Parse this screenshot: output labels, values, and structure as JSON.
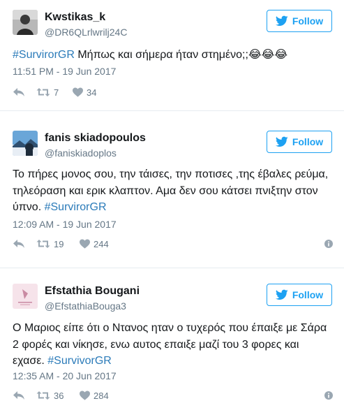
{
  "tweets": [
    {
      "name": "Kwstikas_k",
      "handle": "@DR6QLrlwrilj24C",
      "follow_label": "Follow",
      "text_hashtag": "#SurvirorGR",
      "text_body": " Μήπως και σήμερα ήταν στημένο;;",
      "text_emoji": "😂😂😂",
      "timestamp": "11:51 PM - 19 Jun 2017",
      "retweets": "7",
      "likes": "34"
    },
    {
      "name": "fanis skiadopoulos",
      "handle": "@faniskiadoplos",
      "follow_label": "Follow",
      "text_body": "Το πήρες μονος σου, την τάισες, την ποτισες ,της έβαλες ρεύμα, τηλεόραση και ερικ κλαπτον. Αμα δεν σου κάτσει πνιξτην στον ύπνο.",
      "text_hashtag": "#SurvirorGR",
      "timestamp": "12:09 AM - 19 Jun 2017",
      "retweets": "19",
      "likes": "244"
    },
    {
      "name": "Efstathia Bougani",
      "handle": "@EfstathiaBouga3",
      "follow_label": "Follow",
      "text_body": "Ο Μαριος είπε ότι ο Ντανος ηταν ο τυχερός που έπαιξε με Σάρα 2 φορές και νίκησε, ενω αυτος επαιξε μαζί του 3 φορες και εχασε.",
      "text_hashtag": "#SurvivorGR",
      "timestamp": "12:35 AM - 20 Jun 2017",
      "retweets": "36",
      "likes": "284"
    }
  ],
  "colors": {
    "accent": "#1da1f2",
    "hashtag": "#2b7bb9",
    "muted": "#657786",
    "divider": "#e6ecf0"
  },
  "icons": [
    "twitter-bird-icon",
    "reply-icon",
    "retweet-icon",
    "heart-icon",
    "info-icon"
  ]
}
